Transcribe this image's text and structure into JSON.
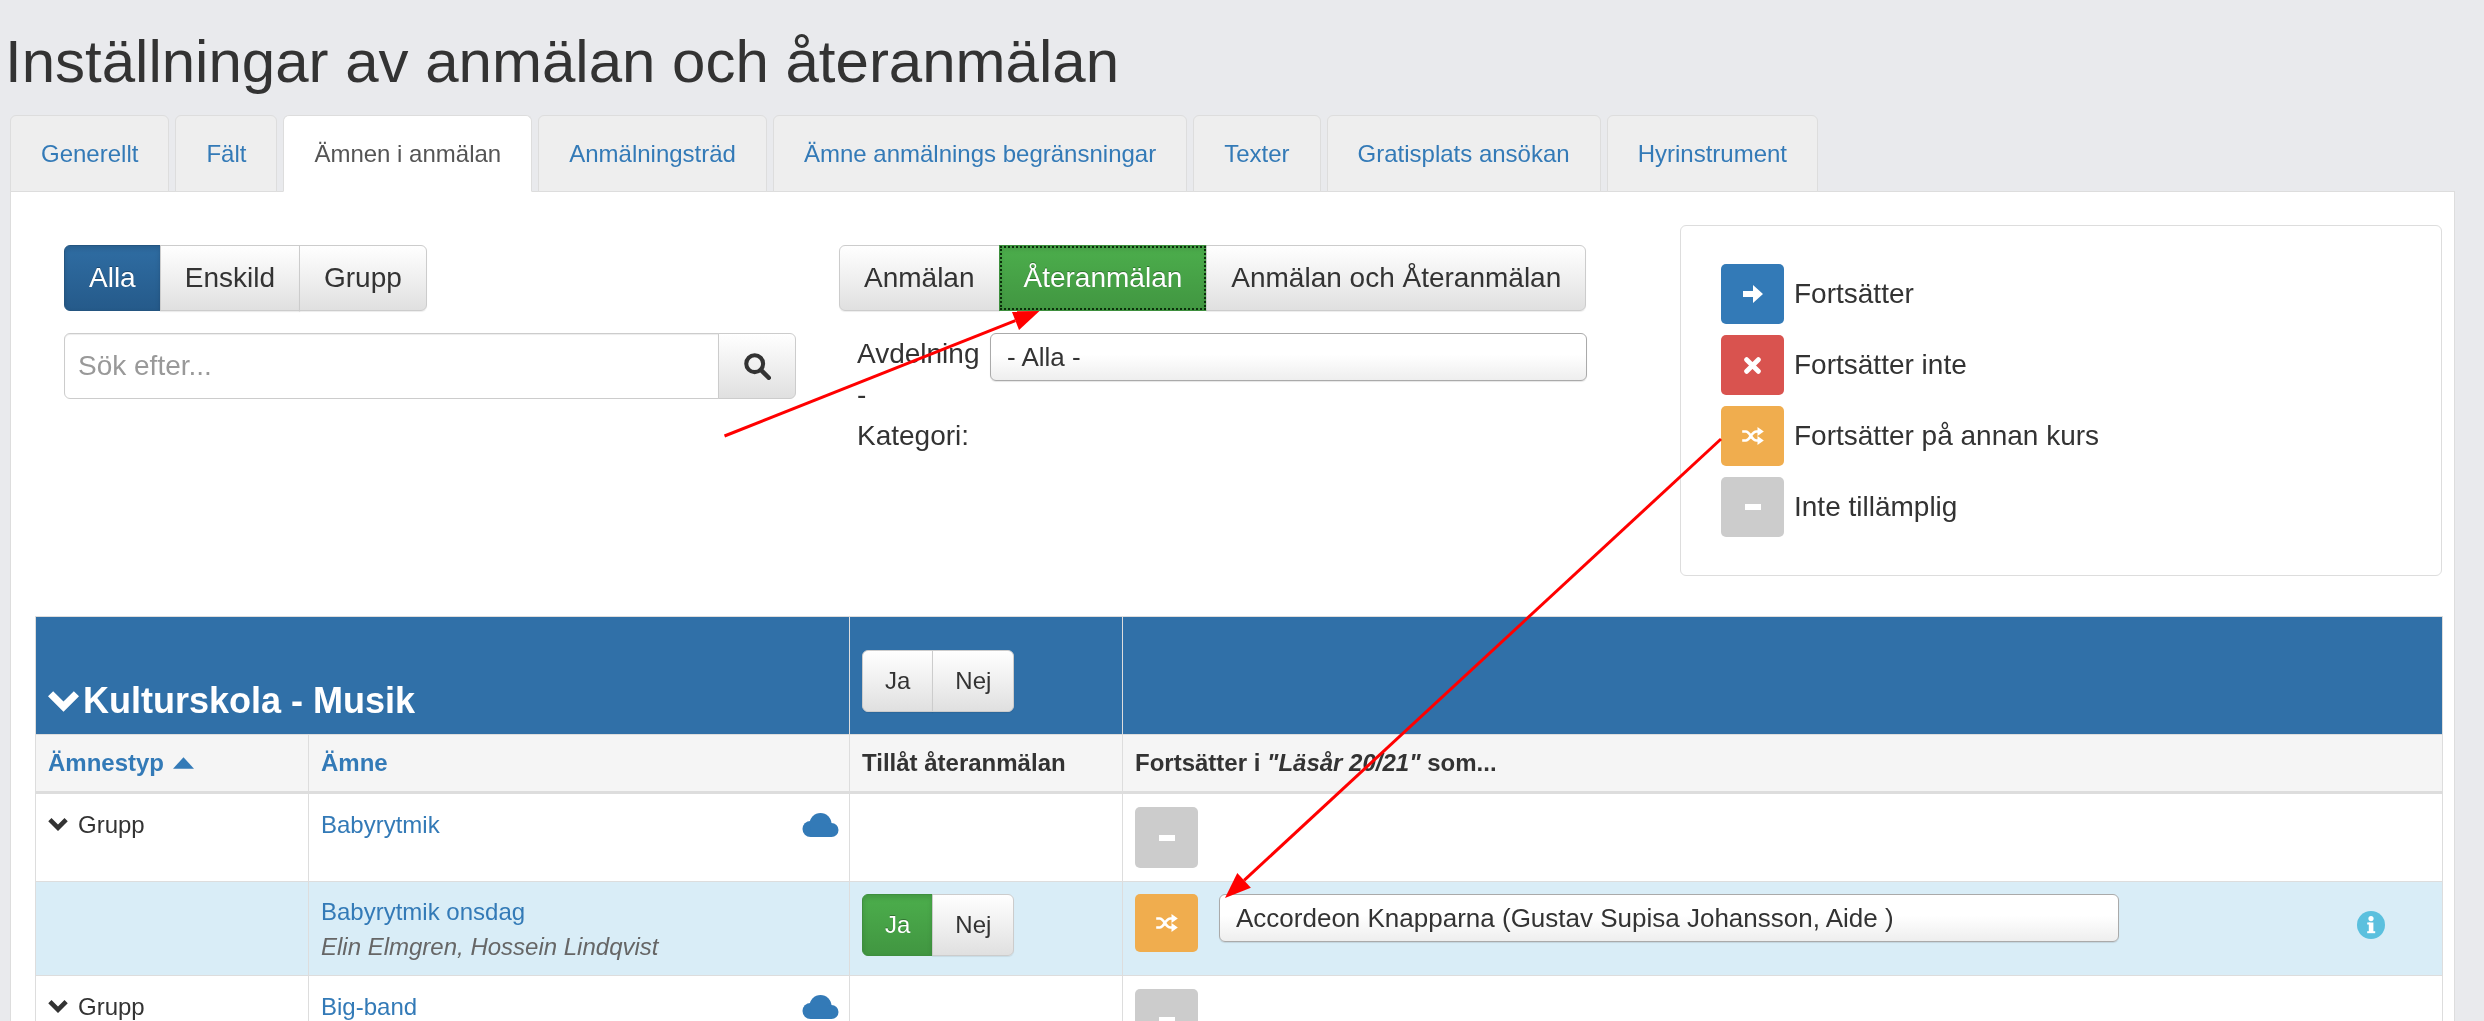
{
  "page": {
    "title": "Inställningar av anmälan och återanmälan"
  },
  "tabs": [
    {
      "label": "Generellt",
      "selected": false
    },
    {
      "label": "Fält",
      "selected": false
    },
    {
      "label": "Ämnen i anmälan",
      "selected": true
    },
    {
      "label": "Anmälningsträd",
      "selected": false
    },
    {
      "label": "Ämne anmälnings begränsningar",
      "selected": false
    },
    {
      "label": "Texter",
      "selected": false
    },
    {
      "label": "Gratisplats ansökan",
      "selected": false
    },
    {
      "label": "Hyrinstrument",
      "selected": false
    }
  ],
  "filters": {
    "type_buttons": [
      {
        "label": "Alla",
        "selected": true
      },
      {
        "label": "Enskild",
        "selected": false
      },
      {
        "label": "Grupp",
        "selected": false
      }
    ],
    "search": {
      "placeholder": "Sök efter..."
    },
    "mode_buttons": [
      {
        "label": "Anmälan",
        "selected": false,
        "focused": false
      },
      {
        "label": "Återanmälan",
        "selected": true,
        "focused": true
      },
      {
        "label": "Anmälan och Återanmälan",
        "selected": false,
        "focused": false
      }
    ],
    "department": {
      "label": "Avdelning - Kategori:",
      "value": "- Alla -"
    }
  },
  "legend": [
    {
      "kind": "continues",
      "label": "Fortsätter",
      "color": "#337ab7"
    },
    {
      "kind": "stops",
      "label": "Fortsätter inte",
      "color": "#d9534f"
    },
    {
      "kind": "other_course",
      "label": "Fortsätter på annan kurs",
      "color": "#f0ad4e"
    },
    {
      "kind": "not_applicable",
      "label": "Inte tillämplig",
      "color": "#cccccc"
    }
  ],
  "table": {
    "group_title": "Kulturskola - Musik",
    "expanded": true,
    "bulk_buttons": [
      {
        "label": "Ja",
        "selected": false
      },
      {
        "label": "Nej",
        "selected": false
      }
    ],
    "columns": [
      {
        "label": "Ämnestyp",
        "kind": "sortable",
        "sorted": true
      },
      {
        "label": "Ämne",
        "kind": "sortable",
        "sorted": false
      },
      {
        "label": "Tillåt återanmälan",
        "kind": "plain",
        "sorted": false
      },
      {
        "label": "Fortsätter i *\"Läsår 20/21\"* som...",
        "kind": "plain",
        "sorted": false
      }
    ],
    "rows": [
      {
        "kind": "subject",
        "type": "Grupp",
        "expanded": true,
        "subject": "Babyrytmik",
        "cloud": true,
        "continuation": {
          "kind": "not_applicable"
        },
        "children": [
          {
            "kind": "course",
            "subject": "Babyrytmik onsdag",
            "teachers": "Elin Elmgren, Hossein Lindqvist",
            "allow": [
              {
                "label": "Ja",
                "selected": true
              },
              {
                "label": "Nej",
                "selected": false
              }
            ],
            "continuation": {
              "kind": "other_course"
            },
            "target": "Accordeon Knapparna (Gustav Supisa Johansson, Aide )",
            "info": true
          }
        ]
      },
      {
        "kind": "subject",
        "type": "Grupp",
        "expanded": true,
        "subject": "Big-band",
        "cloud": true,
        "continuation": {
          "kind": "not_applicable"
        }
      }
    ]
  }
}
